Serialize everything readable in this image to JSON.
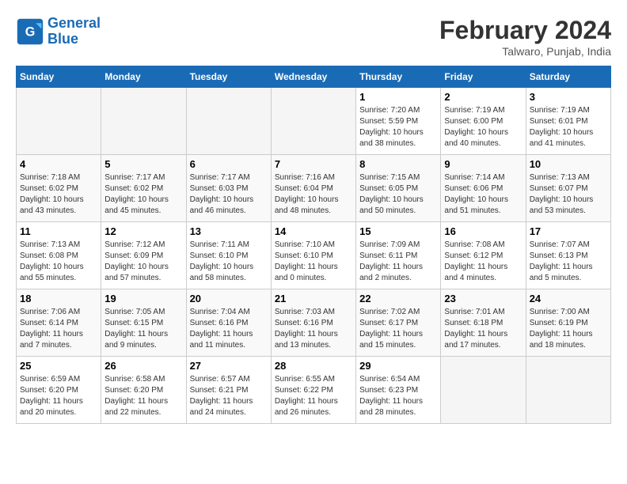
{
  "header": {
    "logo_line1": "General",
    "logo_line2": "Blue",
    "month_title": "February 2024",
    "location": "Talwaro, Punjab, India"
  },
  "days_of_week": [
    "Sunday",
    "Monday",
    "Tuesday",
    "Wednesday",
    "Thursday",
    "Friday",
    "Saturday"
  ],
  "weeks": [
    [
      {
        "day": "",
        "info": ""
      },
      {
        "day": "",
        "info": ""
      },
      {
        "day": "",
        "info": ""
      },
      {
        "day": "",
        "info": ""
      },
      {
        "day": "1",
        "info": "Sunrise: 7:20 AM\nSunset: 5:59 PM\nDaylight: 10 hours\nand 38 minutes."
      },
      {
        "day": "2",
        "info": "Sunrise: 7:19 AM\nSunset: 6:00 PM\nDaylight: 10 hours\nand 40 minutes."
      },
      {
        "day": "3",
        "info": "Sunrise: 7:19 AM\nSunset: 6:01 PM\nDaylight: 10 hours\nand 41 minutes."
      }
    ],
    [
      {
        "day": "4",
        "info": "Sunrise: 7:18 AM\nSunset: 6:02 PM\nDaylight: 10 hours\nand 43 minutes."
      },
      {
        "day": "5",
        "info": "Sunrise: 7:17 AM\nSunset: 6:02 PM\nDaylight: 10 hours\nand 45 minutes."
      },
      {
        "day": "6",
        "info": "Sunrise: 7:17 AM\nSunset: 6:03 PM\nDaylight: 10 hours\nand 46 minutes."
      },
      {
        "day": "7",
        "info": "Sunrise: 7:16 AM\nSunset: 6:04 PM\nDaylight: 10 hours\nand 48 minutes."
      },
      {
        "day": "8",
        "info": "Sunrise: 7:15 AM\nSunset: 6:05 PM\nDaylight: 10 hours\nand 50 minutes."
      },
      {
        "day": "9",
        "info": "Sunrise: 7:14 AM\nSunset: 6:06 PM\nDaylight: 10 hours\nand 51 minutes."
      },
      {
        "day": "10",
        "info": "Sunrise: 7:13 AM\nSunset: 6:07 PM\nDaylight: 10 hours\nand 53 minutes."
      }
    ],
    [
      {
        "day": "11",
        "info": "Sunrise: 7:13 AM\nSunset: 6:08 PM\nDaylight: 10 hours\nand 55 minutes."
      },
      {
        "day": "12",
        "info": "Sunrise: 7:12 AM\nSunset: 6:09 PM\nDaylight: 10 hours\nand 57 minutes."
      },
      {
        "day": "13",
        "info": "Sunrise: 7:11 AM\nSunset: 6:10 PM\nDaylight: 10 hours\nand 58 minutes."
      },
      {
        "day": "14",
        "info": "Sunrise: 7:10 AM\nSunset: 6:10 PM\nDaylight: 11 hours\nand 0 minutes."
      },
      {
        "day": "15",
        "info": "Sunrise: 7:09 AM\nSunset: 6:11 PM\nDaylight: 11 hours\nand 2 minutes."
      },
      {
        "day": "16",
        "info": "Sunrise: 7:08 AM\nSunset: 6:12 PM\nDaylight: 11 hours\nand 4 minutes."
      },
      {
        "day": "17",
        "info": "Sunrise: 7:07 AM\nSunset: 6:13 PM\nDaylight: 11 hours\nand 5 minutes."
      }
    ],
    [
      {
        "day": "18",
        "info": "Sunrise: 7:06 AM\nSunset: 6:14 PM\nDaylight: 11 hours\nand 7 minutes."
      },
      {
        "day": "19",
        "info": "Sunrise: 7:05 AM\nSunset: 6:15 PM\nDaylight: 11 hours\nand 9 minutes."
      },
      {
        "day": "20",
        "info": "Sunrise: 7:04 AM\nSunset: 6:16 PM\nDaylight: 11 hours\nand 11 minutes."
      },
      {
        "day": "21",
        "info": "Sunrise: 7:03 AM\nSunset: 6:16 PM\nDaylight: 11 hours\nand 13 minutes."
      },
      {
        "day": "22",
        "info": "Sunrise: 7:02 AM\nSunset: 6:17 PM\nDaylight: 11 hours\nand 15 minutes."
      },
      {
        "day": "23",
        "info": "Sunrise: 7:01 AM\nSunset: 6:18 PM\nDaylight: 11 hours\nand 17 minutes."
      },
      {
        "day": "24",
        "info": "Sunrise: 7:00 AM\nSunset: 6:19 PM\nDaylight: 11 hours\nand 18 minutes."
      }
    ],
    [
      {
        "day": "25",
        "info": "Sunrise: 6:59 AM\nSunset: 6:20 PM\nDaylight: 11 hours\nand 20 minutes."
      },
      {
        "day": "26",
        "info": "Sunrise: 6:58 AM\nSunset: 6:20 PM\nDaylight: 11 hours\nand 22 minutes."
      },
      {
        "day": "27",
        "info": "Sunrise: 6:57 AM\nSunset: 6:21 PM\nDaylight: 11 hours\nand 24 minutes."
      },
      {
        "day": "28",
        "info": "Sunrise: 6:55 AM\nSunset: 6:22 PM\nDaylight: 11 hours\nand 26 minutes."
      },
      {
        "day": "29",
        "info": "Sunrise: 6:54 AM\nSunset: 6:23 PM\nDaylight: 11 hours\nand 28 minutes."
      },
      {
        "day": "",
        "info": ""
      },
      {
        "day": "",
        "info": ""
      }
    ]
  ]
}
